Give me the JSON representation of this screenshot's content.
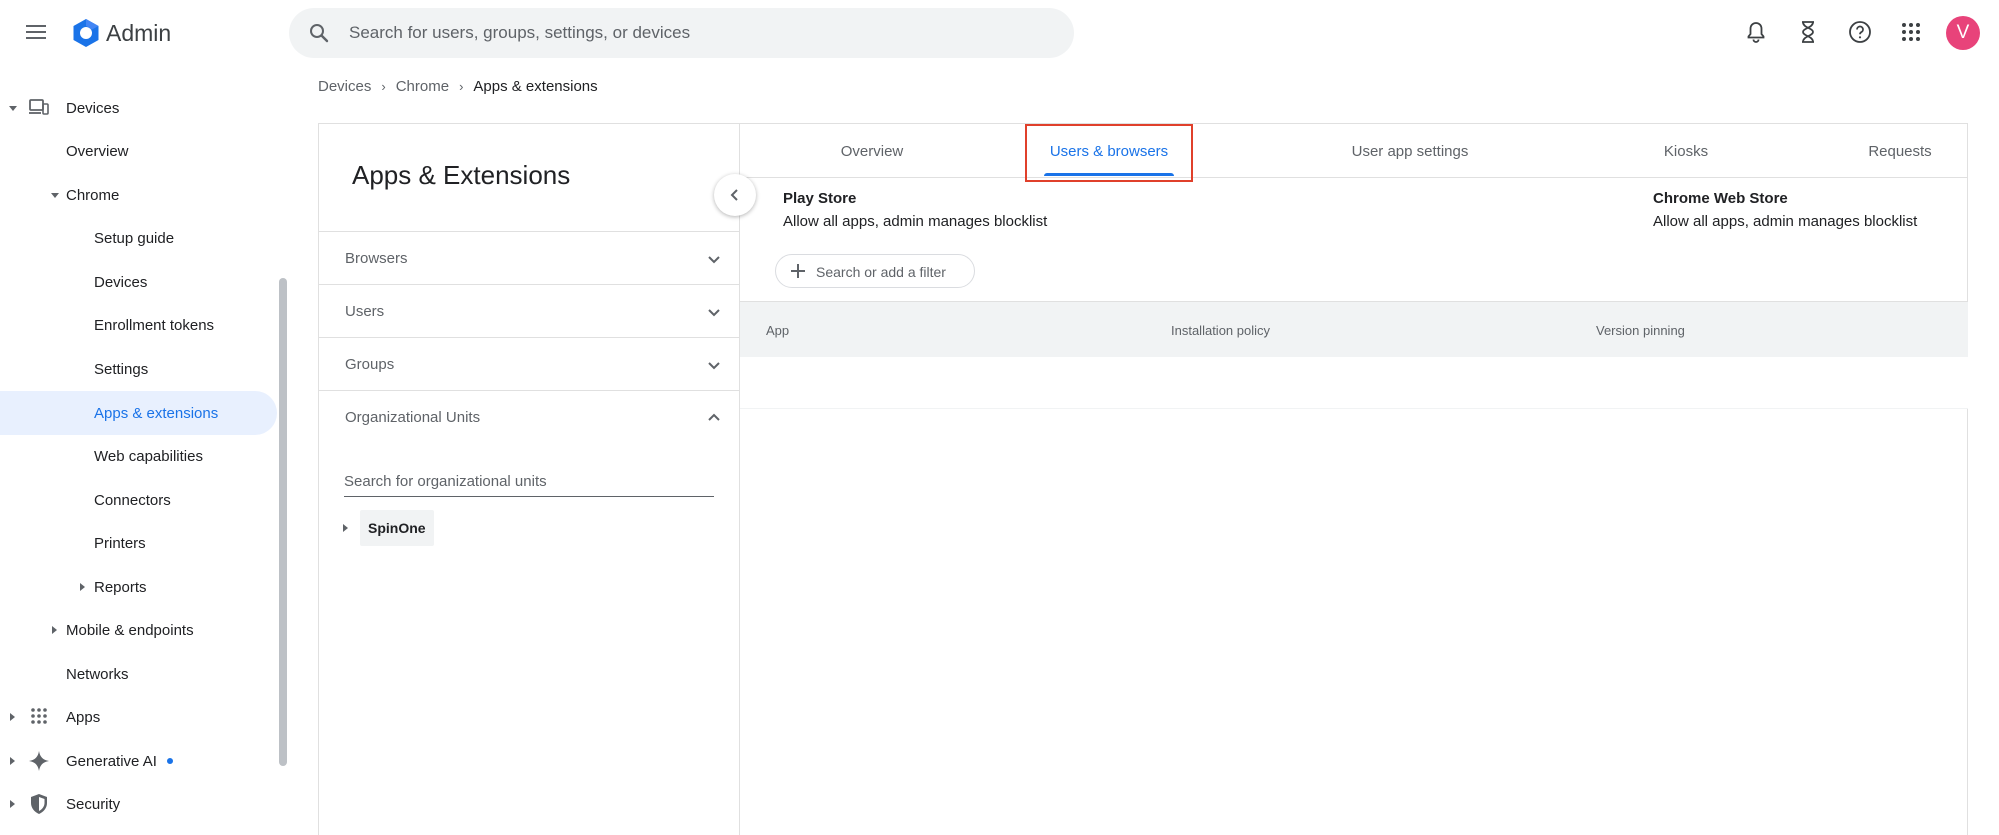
{
  "app": {
    "brand": "Admin"
  },
  "search": {
    "placeholder": "Search for users, groups, settings, or devices"
  },
  "header": {
    "avatar_letter": "V"
  },
  "colors": {
    "accent": "#1a73e8",
    "highlight": "#e0402b",
    "avatar": "#e8437a"
  },
  "sidebar": {
    "items": [
      {
        "label": "Devices"
      },
      {
        "label": "Overview"
      },
      {
        "label": "Chrome"
      },
      {
        "label": "Setup guide"
      },
      {
        "label": "Devices"
      },
      {
        "label": "Enrollment tokens"
      },
      {
        "label": "Settings"
      },
      {
        "label": "Apps & extensions"
      },
      {
        "label": "Web capabilities"
      },
      {
        "label": "Connectors"
      },
      {
        "label": "Printers"
      },
      {
        "label": "Reports"
      },
      {
        "label": "Mobile & endpoints"
      },
      {
        "label": "Networks"
      },
      {
        "label": "Apps"
      },
      {
        "label": "Generative AI"
      },
      {
        "label": "Security"
      }
    ]
  },
  "breadcrumb": {
    "items": [
      "Devices",
      "Chrome",
      "Apps & extensions"
    ]
  },
  "left_panel": {
    "title": "Apps & Extensions",
    "filters": [
      "Browsers",
      "Users",
      "Groups",
      "Organizational Units"
    ],
    "ou_search_placeholder": "Search for organizational units",
    "ou_root": "SpinOne"
  },
  "tabs": [
    "Overview",
    "Users & browsers",
    "User app settings",
    "Kiosks",
    "Requests"
  ],
  "stores": {
    "play": {
      "title": "Play Store",
      "desc": "Allow all apps, admin manages blocklist"
    },
    "chrome": {
      "title": "Chrome Web Store",
      "desc": "Allow all apps, admin manages blocklist"
    }
  },
  "filter_chip": {
    "label": "Search or add a filter"
  },
  "table": {
    "columns": [
      "App",
      "Installation policy",
      "Version pinning"
    ]
  }
}
